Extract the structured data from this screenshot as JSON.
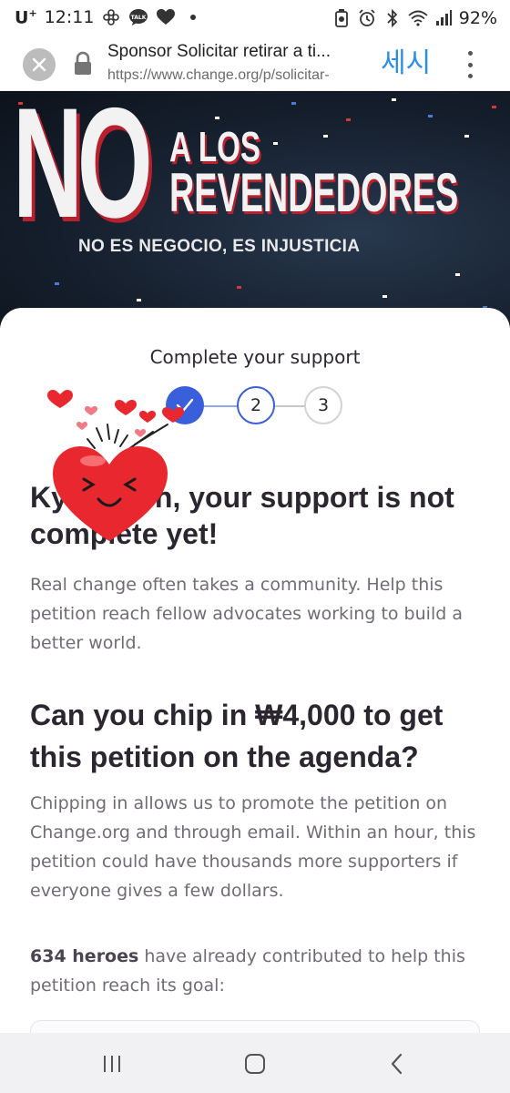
{
  "status_bar": {
    "carrier": "U",
    "carrier_sup": "+",
    "time": "12:11",
    "left_icons": [
      "pinwheel-icon",
      "kakaotalk-icon",
      "heart-icon",
      "dot-icon"
    ],
    "kakao_label": "TALK",
    "right_icons": [
      "battery-saver-icon",
      "alarm-icon",
      "bluetooth-icon",
      "wifi-icon",
      "signal-icon"
    ],
    "battery": "92%"
  },
  "browser": {
    "title": "Sponsor Solicitar retirar a ti...",
    "url": "https://www.change.org/p/solicitar-",
    "overlay_text": "세시"
  },
  "hero": {
    "big_word": "NO",
    "line1": "A LOS",
    "line2": "REVENDEDORES",
    "tagline": "NO ES NEGOCIO, ES INJUSTICIA"
  },
  "sheet": {
    "title": "Complete your support",
    "steps": [
      {
        "label": "✓",
        "state": "done"
      },
      {
        "label": "2",
        "state": "current"
      },
      {
        "label": "3",
        "state": "upcoming"
      }
    ],
    "headline": "Ky        n, your support is not complete yet!",
    "headline_visible_part": "n, your support is not",
    "headline_line2": "complete yet!",
    "paragraph1": "Real change often takes a community. Help this petition reach fellow advocates working to build a better world.",
    "headline2": "Can you chip in ₩4,000 to get this petition on the agenda?",
    "paragraph2": "Chipping in allows us to promote the petition on Change.org and through email. Within an hour, this petition could have thousands more supporters if everyone gives a few dollars.",
    "heroes_count": "634 heroes",
    "paragraph3_rest": " have already contributed to help this petition reach its goal:"
  },
  "colors": {
    "accent": "#3a5fdb",
    "text": "#2b2630",
    "muted": "#706b77",
    "hero_red": "#b8202e",
    "sticker_red": "#e8282e",
    "overlay_blue": "#2c8ee8"
  },
  "nav": {
    "buttons": [
      "recent-apps-icon",
      "home-icon",
      "back-icon"
    ]
  }
}
